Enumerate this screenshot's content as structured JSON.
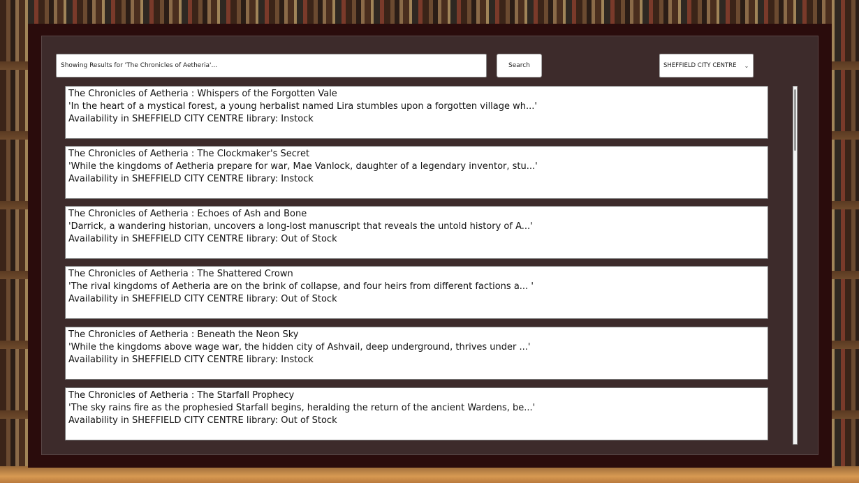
{
  "search": {
    "placeholder": "Showing Results for 'The Chronicles of Aetheria'...",
    "button_label": "Search"
  },
  "library_select": {
    "selected": "SHEFFIELD CITY CENTRE"
  },
  "results": [
    {
      "title": "The Chronicles of Aetheria : Whispers of the Forgotten Vale",
      "summary": "'In the heart of a mystical forest, a young herbalist named Lira stumbles upon a forgotten village wh...'",
      "availability": "Availability in SHEFFIELD CITY CENTRE library: Instock"
    },
    {
      "title": "The Chronicles of Aetheria : The Clockmaker's Secret",
      "summary": "'While the kingdoms of Aetheria prepare for war, Mae Vanlock, daughter of a legendary inventor, stu...'",
      "availability": "Availability in SHEFFIELD CITY CENTRE library: Instock"
    },
    {
      "title": "The Chronicles of Aetheria : Echoes of Ash and Bone",
      "summary": "'Darrick, a wandering historian, uncovers a long-lost manuscript that reveals the untold history of A...'",
      "availability": "Availability in SHEFFIELD CITY CENTRE library: Out of Stock"
    },
    {
      "title": "The Chronicles of Aetheria : The Shattered Crown",
      "summary": "'The rival kingdoms of Aetheria are on the brink of collapse, and four heirs from different factions a... '",
      "availability": "Availability in SHEFFIELD CITY CENTRE library: Out of Stock"
    },
    {
      "title": "The Chronicles of Aetheria : Beneath the Neon Sky",
      "summary": "'While the kingdoms above wage war, the hidden city of Ashvail, deep underground, thrives under ...'",
      "availability": "Availability in SHEFFIELD CITY CENTRE library: Instock"
    },
    {
      "title": "The Chronicles of Aetheria : The Starfall Prophecy",
      "summary": "'The sky rains fire as the prophesied Starfall begins, heralding the return of the ancient Wardens, be...'",
      "availability": "Availability in SHEFFIELD CITY CENTRE library: Out of Stock"
    }
  ],
  "icons": {
    "dropdown": "chevron-down-icon"
  }
}
